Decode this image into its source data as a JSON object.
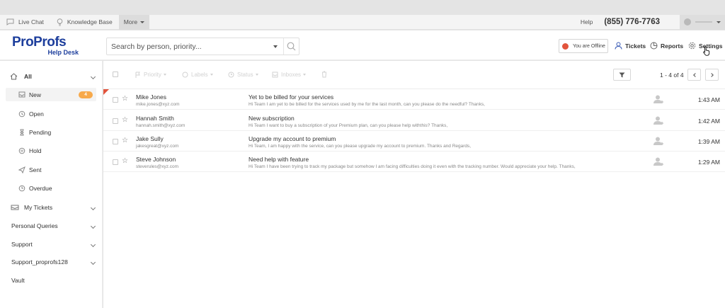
{
  "topbar": {
    "live_chat": "Live Chat",
    "knowledge_base": "Knowledge Base",
    "more": "More",
    "help": "Help",
    "phone": "(855) 776-7763"
  },
  "header": {
    "logo_main": "ProProfs",
    "logo_sub": "Help Desk",
    "search_placeholder": "Search by person, priority...",
    "status": "You are Offline",
    "status_color": "#e2543c",
    "tickets": "Tickets",
    "reports": "Reports",
    "settings": "Settings"
  },
  "sidebar": {
    "all": "All",
    "items": [
      {
        "label": "New",
        "count": "4",
        "icon": "inbox-icon"
      },
      {
        "label": "Open",
        "icon": "open-icon"
      },
      {
        "label": "Pending",
        "icon": "hourglass-icon"
      },
      {
        "label": "Hold",
        "icon": "pause-icon"
      },
      {
        "label": "Sent",
        "icon": "send-icon"
      },
      {
        "label": "Overdue",
        "icon": "clock-icon"
      }
    ],
    "groups": [
      {
        "label": "My Tickets",
        "expandable": true
      },
      {
        "label": "Personal Queries",
        "expandable": true
      },
      {
        "label": "Support",
        "expandable": true
      },
      {
        "label": "Support_proprofs128",
        "expandable": true
      },
      {
        "label": "Vault",
        "expandable": false
      }
    ]
  },
  "toolbar": {
    "priority": "Priority",
    "labels": "Labels",
    "status": "Status",
    "inboxes": "Inboxes",
    "pagination": "1 - 4 of 4"
  },
  "tickets": [
    {
      "name": "Mike Jones",
      "email": "mike.jones@xyz.com",
      "subject": "Yet to be billed for your services",
      "preview": "Hi Team I am yet to be billed for the services used by me for the last month, can you please do the needful? Thanks,",
      "time": "1:43 AM",
      "flagged": true
    },
    {
      "name": "Hannah Smith",
      "email": "hannah.smith@xyz.com",
      "subject": "New subscription",
      "preview": "Hi Team I want to buy a subscription of your Premium plan, can you please help withthis? Thanks,",
      "time": "1:42 AM",
      "flagged": false
    },
    {
      "name": "Jake Sully",
      "email": "jakesgreat@xyz.com",
      "subject": "Upgrade my account to premium",
      "preview": "Hi Team, I am happy with the service, can you please upgrade my account to premium. Thanks and Regards,",
      "time": "1:39 AM",
      "flagged": false
    },
    {
      "name": "Steve Johnson",
      "email": "steverules@xyz.com",
      "subject": "Need help with feature",
      "preview": "Hi Team I have been trying to track my package but somehow I am facing difficulties doing it even with the tracking number. Would appreciate your help. Thanks,",
      "time": "1:29 AM",
      "flagged": false
    }
  ]
}
